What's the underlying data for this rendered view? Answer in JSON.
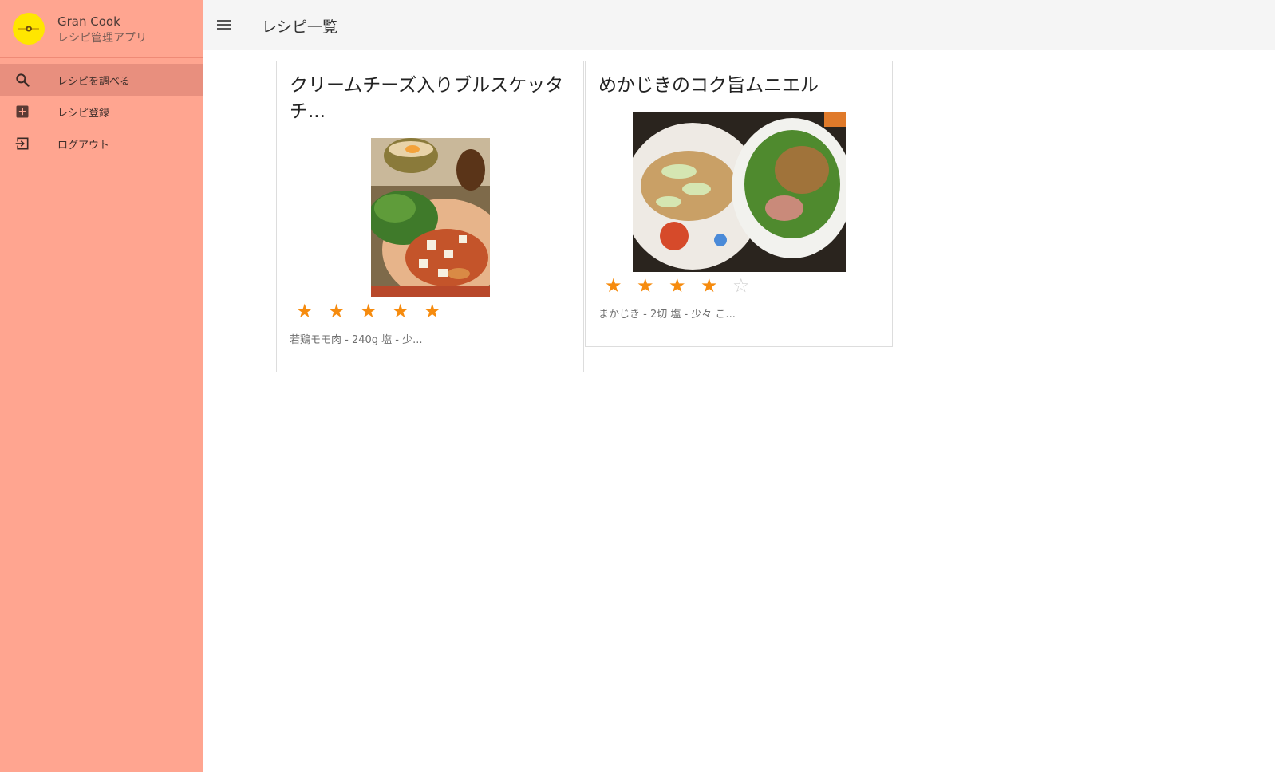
{
  "app": {
    "name": "Gran Cook",
    "subtitle": "レシピ管理アプリ",
    "logo_icon": "sunflower-logo-icon"
  },
  "sidebar": {
    "items": [
      {
        "label": "レシピを調べる",
        "icon": "search-icon",
        "active": true
      },
      {
        "label": "レシピ登録",
        "icon": "add-box-icon",
        "active": false
      },
      {
        "label": "ログアウト",
        "icon": "logout-icon",
        "active": false
      }
    ]
  },
  "header": {
    "menu_icon": "menu-icon",
    "title": "レシピ一覧"
  },
  "recipes": [
    {
      "title": "クリームチーズ入りブルスケッタチ...",
      "rating": 5,
      "rating_max": 5,
      "ingredients_preview": "若鶏モモ肉 - 240g 塩 - 少..."
    },
    {
      "title": "めかじきのコク旨ムニエル",
      "rating": 4,
      "rating_max": 5,
      "ingredients_preview": "まかじき - 2切 塩 - 少々 こ..."
    }
  ],
  "colors": {
    "sidebar_bg": "#ffa590",
    "sidebar_active": "#e88f7e",
    "topbar_bg": "#f5f5f5",
    "star": "#f68b0e",
    "logo": "#ffe600"
  }
}
